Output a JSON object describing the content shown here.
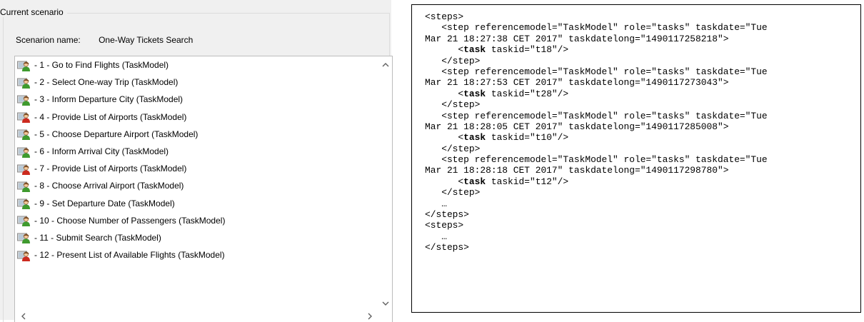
{
  "panel": {
    "title": "Current scenario",
    "scenario_label": "Scenarion name:",
    "scenario_name": "One-Way Tickets Search"
  },
  "list": {
    "items": [
      {
        "label": "- 1 - Go to Find Flights (TaskModel)",
        "icon": "user-task-icon",
        "task_type": "user"
      },
      {
        "label": "- 2 - Select One-way Trip (TaskModel)",
        "icon": "user-task-icon",
        "task_type": "user"
      },
      {
        "label": "- 3 - Inform Departure City (TaskModel)",
        "icon": "user-task-icon",
        "task_type": "user"
      },
      {
        "label": "- 4 - Provide List of Airports (TaskModel)",
        "icon": "system-task-icon",
        "task_type": "system"
      },
      {
        "label": "- 5 - Choose Departure Airport (TaskModel)",
        "icon": "user-task-icon",
        "task_type": "user"
      },
      {
        "label": "- 6 - Inform Arrival City (TaskModel)",
        "icon": "user-task-icon",
        "task_type": "user"
      },
      {
        "label": "- 7 - Provide List of Airports (TaskModel)",
        "icon": "system-task-icon",
        "task_type": "system"
      },
      {
        "label": "- 8 - Choose Arrival Airport (TaskModel)",
        "icon": "user-task-icon",
        "task_type": "user"
      },
      {
        "label": "- 9 - Set Departure Date (TaskModel)",
        "icon": "user-task-icon",
        "task_type": "user"
      },
      {
        "label": "- 10 - Choose Number of Passengers (TaskModel)",
        "icon": "user-task-icon",
        "task_type": "user"
      },
      {
        "label": "- 11 - Submit Search (TaskModel)",
        "icon": "user-task-icon",
        "task_type": "user"
      },
      {
        "label": "- 12 - Present List of Available Flights (TaskModel)",
        "icon": "system-task-icon",
        "task_type": "system"
      }
    ]
  },
  "colors": {
    "user_task": "#3f9a2e",
    "system_task": "#cc2a1f",
    "head": "#f4c99c"
  },
  "xml": {
    "lines": [
      {
        "text": "<steps>"
      },
      {
        "text": "   <step referencemodel=\"TaskModel\" role=\"tasks\" taskdate=\"Tue"
      },
      {
        "text": "Mar 21 18:27:38 CET 2017\" taskdatelong=\"1490117258218\">"
      },
      {
        "pre": "      <",
        "bold": "task",
        "post": " taskid=\"t18\"/>"
      },
      {
        "text": "   </step>"
      },
      {
        "text": "   <step referencemodel=\"TaskModel\" role=\"tasks\" taskdate=\"Tue"
      },
      {
        "text": "Mar 21 18:27:53 CET 2017\" taskdatelong=\"1490117273043\">"
      },
      {
        "pre": "      <",
        "bold": "task",
        "post": " taskid=\"t28\"/>"
      },
      {
        "text": "   </step>"
      },
      {
        "text": "   <step referencemodel=\"TaskModel\" role=\"tasks\" taskdate=\"Tue"
      },
      {
        "text": "Mar 21 18:28:05 CET 2017\" taskdatelong=\"1490117285008\">"
      },
      {
        "pre": "      <",
        "bold": "task",
        "post": " taskid=\"t10\"/>"
      },
      {
        "text": "   </step>"
      },
      {
        "text": "   <step referencemodel=\"TaskModel\" role=\"tasks\" taskdate=\"Tue"
      },
      {
        "text": "Mar 21 18:28:18 CET 2017\" taskdatelong=\"1490117298780\">"
      },
      {
        "pre": "      <",
        "bold": "task",
        "post": " taskid=\"t12\"/>"
      },
      {
        "text": "   </step>"
      },
      {
        "text": "   …"
      },
      {
        "text": "</steps>"
      },
      {
        "text": "<steps>"
      },
      {
        "text": "   …"
      },
      {
        "text": "</steps>"
      }
    ]
  }
}
